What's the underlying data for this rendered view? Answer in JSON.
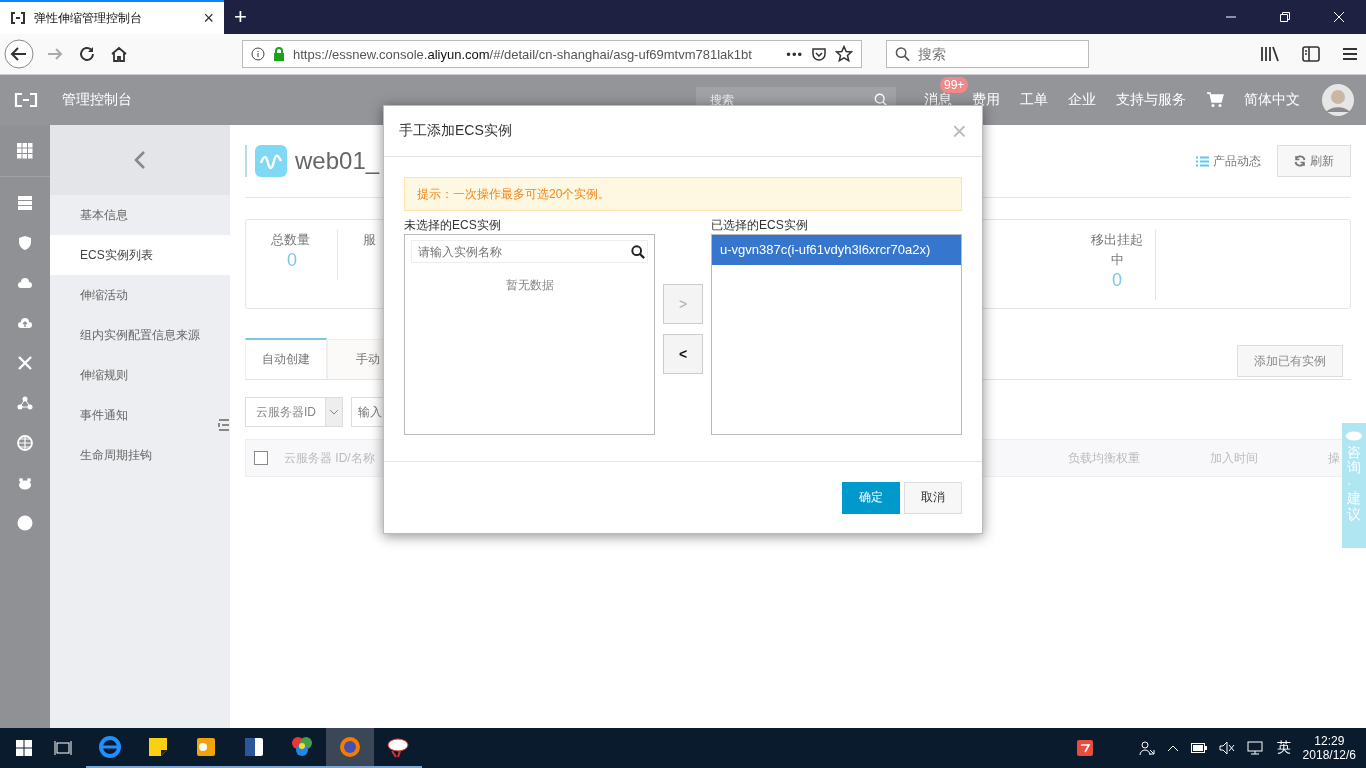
{
  "browser": {
    "tab": {
      "title": "弹性伸缩管理控制台",
      "close": "×"
    },
    "new_tab": "+",
    "url": {
      "prefix": "https://essnew.console.",
      "domain": "aliyun.com",
      "path": "/#/detail/cn-shanghai/asg-uf69mtvm781lak1bt"
    },
    "more": "•••",
    "search": {
      "placeholder": "搜索"
    }
  },
  "console_header": {
    "title": "管理控制台",
    "search": {
      "placeholder": "搜索"
    },
    "nav": [
      {
        "label": "消息",
        "badge": "99+"
      },
      {
        "label": "费用"
      },
      {
        "label": "工单"
      },
      {
        "label": "企业"
      },
      {
        "label": "支持与服务"
      }
    ],
    "language": "简体中文"
  },
  "sidebar": {
    "items": [
      {
        "label": "基本信息",
        "selected": false
      },
      {
        "label": "ECS实例列表",
        "selected": true
      },
      {
        "label": "伸缩活动",
        "selected": false
      },
      {
        "label": "组内实例配置信息来源",
        "selected": false
      },
      {
        "label": "伸缩规则",
        "selected": false
      },
      {
        "label": "事件通知",
        "selected": false
      },
      {
        "label": "生命周期挂钩",
        "selected": false
      }
    ]
  },
  "page": {
    "title": "web01_",
    "product_news": "产品动态",
    "refresh": "刷新",
    "stats": [
      {
        "label": "总数量",
        "value": "0"
      },
      {
        "label": "服"
      }
    ],
    "stats_right": [
      {
        "label": "移出挂起中",
        "value": "0"
      }
    ],
    "tabs": [
      {
        "label": "自动创建",
        "selected": true
      },
      {
        "label": "手动",
        "selected": false
      }
    ],
    "add_existing": "添加已有实例",
    "filter": {
      "select": "云服务器ID",
      "input_placeholder": "输入"
    },
    "table": {
      "columns": [
        "云服务器 ID/名称",
        "负载均衡权重",
        "加入时间",
        "操"
      ],
      "select_all": false
    },
    "feedback": "咨询·建议"
  },
  "dialog": {
    "title": "手工添加ECS实例",
    "close": "×",
    "notice": "提示：一次操作最多可选20个实例。",
    "left": {
      "label": "未选择的ECS实例",
      "search_placeholder": "请输入实例名称",
      "empty": "暂无数据"
    },
    "move_right": {
      "label": ">",
      "disabled": true
    },
    "move_left": {
      "label": "<",
      "disabled": false
    },
    "right": {
      "label": "已选择的ECS实例",
      "items": [
        {
          "text": "u-vgvn387c(i-uf61vdyh3l6xrcr70a2x)",
          "selected": true
        }
      ]
    },
    "ok": "确定",
    "cancel": "取消"
  },
  "taskbar": {
    "apps": [
      {
        "selected": false
      },
      {
        "selected": false
      },
      {
        "selected": false
      },
      {
        "selected": false
      },
      {
        "selected": false
      },
      {
        "selected": true
      },
      {
        "selected": false
      }
    ],
    "ime": "英",
    "time": "12:29",
    "date": "2018/12/6"
  }
}
